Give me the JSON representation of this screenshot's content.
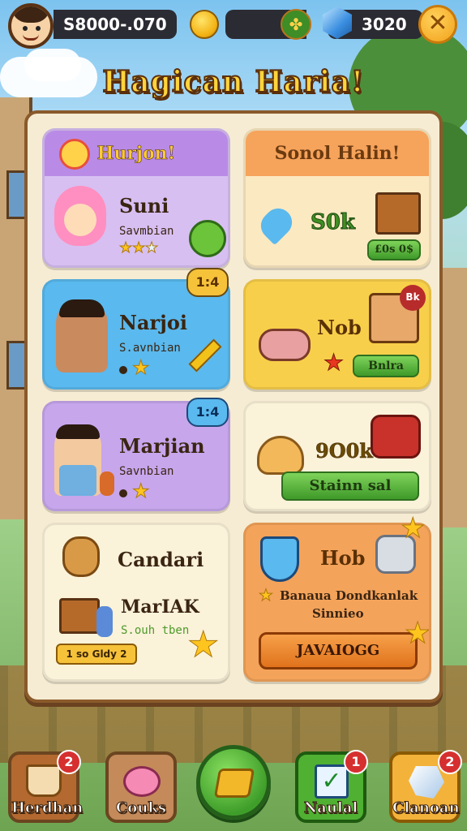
{
  "topbar": {
    "coins_value": "S8000-.070",
    "gems_value": "3020",
    "close_label": "✕"
  },
  "title": "Hagican Haria!",
  "cards": {
    "c1": {
      "header": "Hurjon!",
      "name": "Suni",
      "sub": "Savmbian"
    },
    "c2": {
      "header": "Sonol Halin!",
      "amount": "S0k",
      "price": "£0s 0$"
    },
    "c3": {
      "name": "Narjoi",
      "sub": "S.avnbian",
      "badge": "1:4"
    },
    "c4": {
      "name": "Nob",
      "button": "Bnlra",
      "badge": "Bk"
    },
    "c5": {
      "name": "Marjian",
      "sub": "Savnbian",
      "badge": "1:4"
    },
    "c6": {
      "amount": "9O0k",
      "button": "Stainn sal"
    },
    "c7": {
      "name": "Candari",
      "item": "MarIAK",
      "sub": "S.ouh tben",
      "price": "1 so Gldy 2"
    },
    "c8": {
      "name": "Hob",
      "desc_line1": "Banaua Dondkanlak",
      "desc_line2": "Sinnieo",
      "button": "JAVAIOGG"
    }
  },
  "nav": [
    {
      "label": "Herdhan",
      "badge": "2"
    },
    {
      "label": "Couks",
      "badge": ""
    },
    {
      "label": "",
      "badge": ""
    },
    {
      "label": "Naulal",
      "badge": "1"
    },
    {
      "label": "Clanoan",
      "badge": "2"
    }
  ],
  "colors": {
    "purple": "#c7a6ec",
    "blue": "#5ab9ee",
    "orange": "#f4a35a",
    "yellow": "#f8cf4a",
    "cream": "#fbf2da",
    "green": "#4fb032"
  }
}
